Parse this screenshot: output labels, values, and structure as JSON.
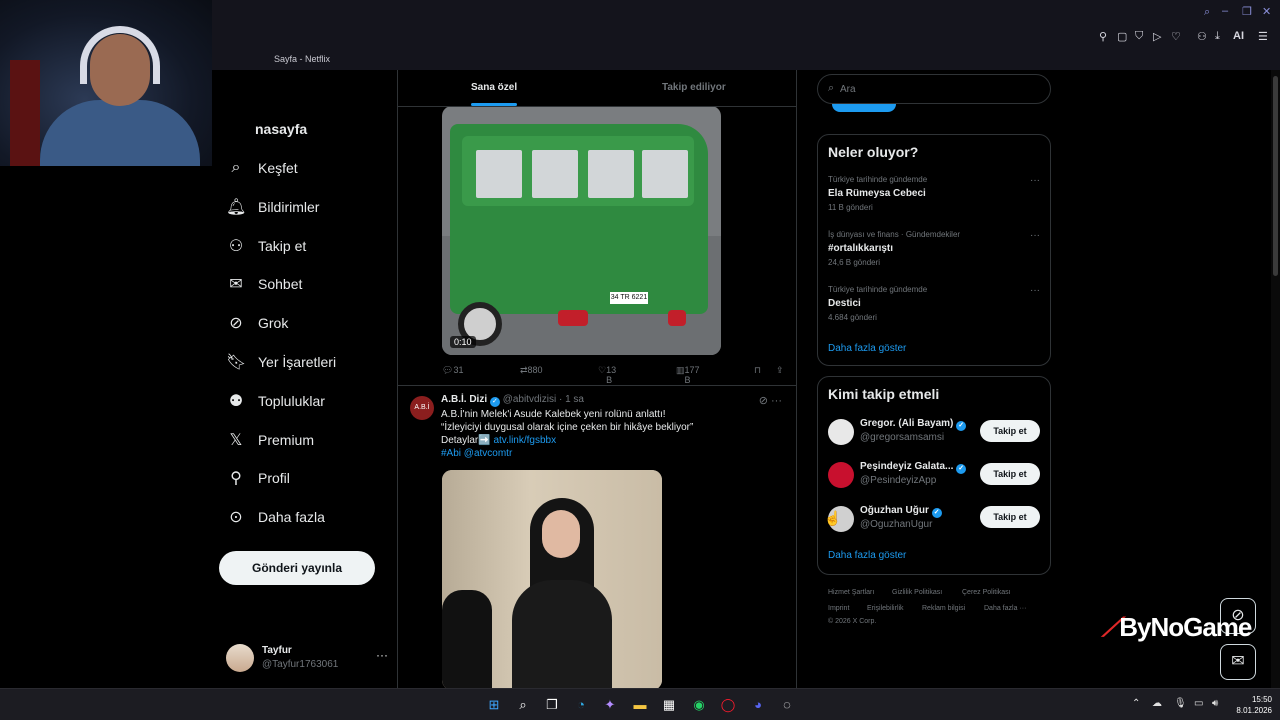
{
  "browser": {
    "tab_title": "Sayfa - Netflix",
    "toolbar_ai_label": "AI"
  },
  "nav": {
    "home": "nasayfa",
    "items": [
      {
        "label": "Keşfet",
        "icon": "search-icon"
      },
      {
        "label": "Bildirimler",
        "icon": "bell-icon"
      },
      {
        "label": "Takip et",
        "icon": "add-person-icon"
      },
      {
        "label": "Sohbet",
        "icon": "mail-icon"
      },
      {
        "label": "Grok",
        "icon": "grok-icon"
      },
      {
        "label": "Yer İşaretleri",
        "icon": "bookmark-icon"
      },
      {
        "label": "Topluluklar",
        "icon": "communities-icon"
      },
      {
        "label": "Premium",
        "icon": "x-icon"
      },
      {
        "label": "Profil",
        "icon": "person-icon"
      },
      {
        "label": "Daha fazla",
        "icon": "more-circle-icon"
      }
    ],
    "post_button": "Gönderi yayınla",
    "account": {
      "name": "Tayfur",
      "handle": "@Tayfur1763061",
      "more": "···"
    }
  },
  "feed": {
    "tabs": [
      "Sana özel",
      "Takip ediliyor"
    ],
    "video_post": {
      "duration": "0:10",
      "plate": "34 TR 6221",
      "replies": "31",
      "reposts": "880",
      "likes": "13 B",
      "views": "177 B"
    },
    "tweet": {
      "avatar_text": "A.B.İ",
      "name": "A.B.İ. Dizi",
      "handle": "@abitvdizisi",
      "time": "· 1 sa",
      "line1": "A.B.İ'nin Melek'i Asude Kalebek yeni rolünü anlattı!",
      "line2": "“İzleyiciyi duygusal olarak içine çeken bir hikâye bekliyor”",
      "line3_prefix": "Detaylar➡️",
      "line3_link": "atv.link/fgsbbx",
      "line4": "#Abi @atvcomtr"
    }
  },
  "right": {
    "search_placeholder": "Ara",
    "trends_title": "Neler oluyor?",
    "trends": [
      {
        "context": "Türkiye tarihinde gündemde",
        "name": "Ela Rümeysa Cebeci",
        "count": "11 B gönderi"
      },
      {
        "context": "İş dünyası ve finans · Gündemdekiler",
        "name": "#ortalıkkarıştı",
        "count": "24,6 B gönderi"
      },
      {
        "context": "Türkiye tarihinde gündemde",
        "name": "Destici",
        "count": "4.684 gönderi"
      }
    ],
    "trends_show_more": "Daha fazla göster",
    "follow_title": "Kimi takip etmeli",
    "follow": [
      {
        "name": "Gregor. (Ali Bayam)",
        "handle": "@gregorsamsamsi",
        "button": "Takip et",
        "avatar_color": "#e8e8e8"
      },
      {
        "name": "Peşindeyiz Galata...",
        "handle": "@PesindeyizApp",
        "button": "Takip et",
        "avatar_color": "#c8102e"
      },
      {
        "name": "Oğuzhan Uğur",
        "handle": "@OguzhanUgur",
        "button": "Takip et",
        "avatar_color": "#d0d0d0"
      }
    ],
    "follow_show_more": "Daha fazla göster",
    "footer": {
      "terms": "Hizmet Şartları",
      "privacy": "Gizlilik Politikası",
      "cookies": "Çerez Politikası",
      "imprint": "Imprint",
      "accessibility": "Erişilebilirlik",
      "ads": "Reklam bilgisi",
      "more": "Daha fazla ···",
      "copyright": "© 2026 X Corp."
    }
  },
  "watermark": {
    "brand": "ByNoGame"
  },
  "taskbar": {
    "time": "15:50",
    "date": "8.01.2026"
  },
  "colors": {
    "accent": "#1d9bf0",
    "background": "#000000",
    "border": "#2f3336",
    "muted": "#71767b"
  }
}
